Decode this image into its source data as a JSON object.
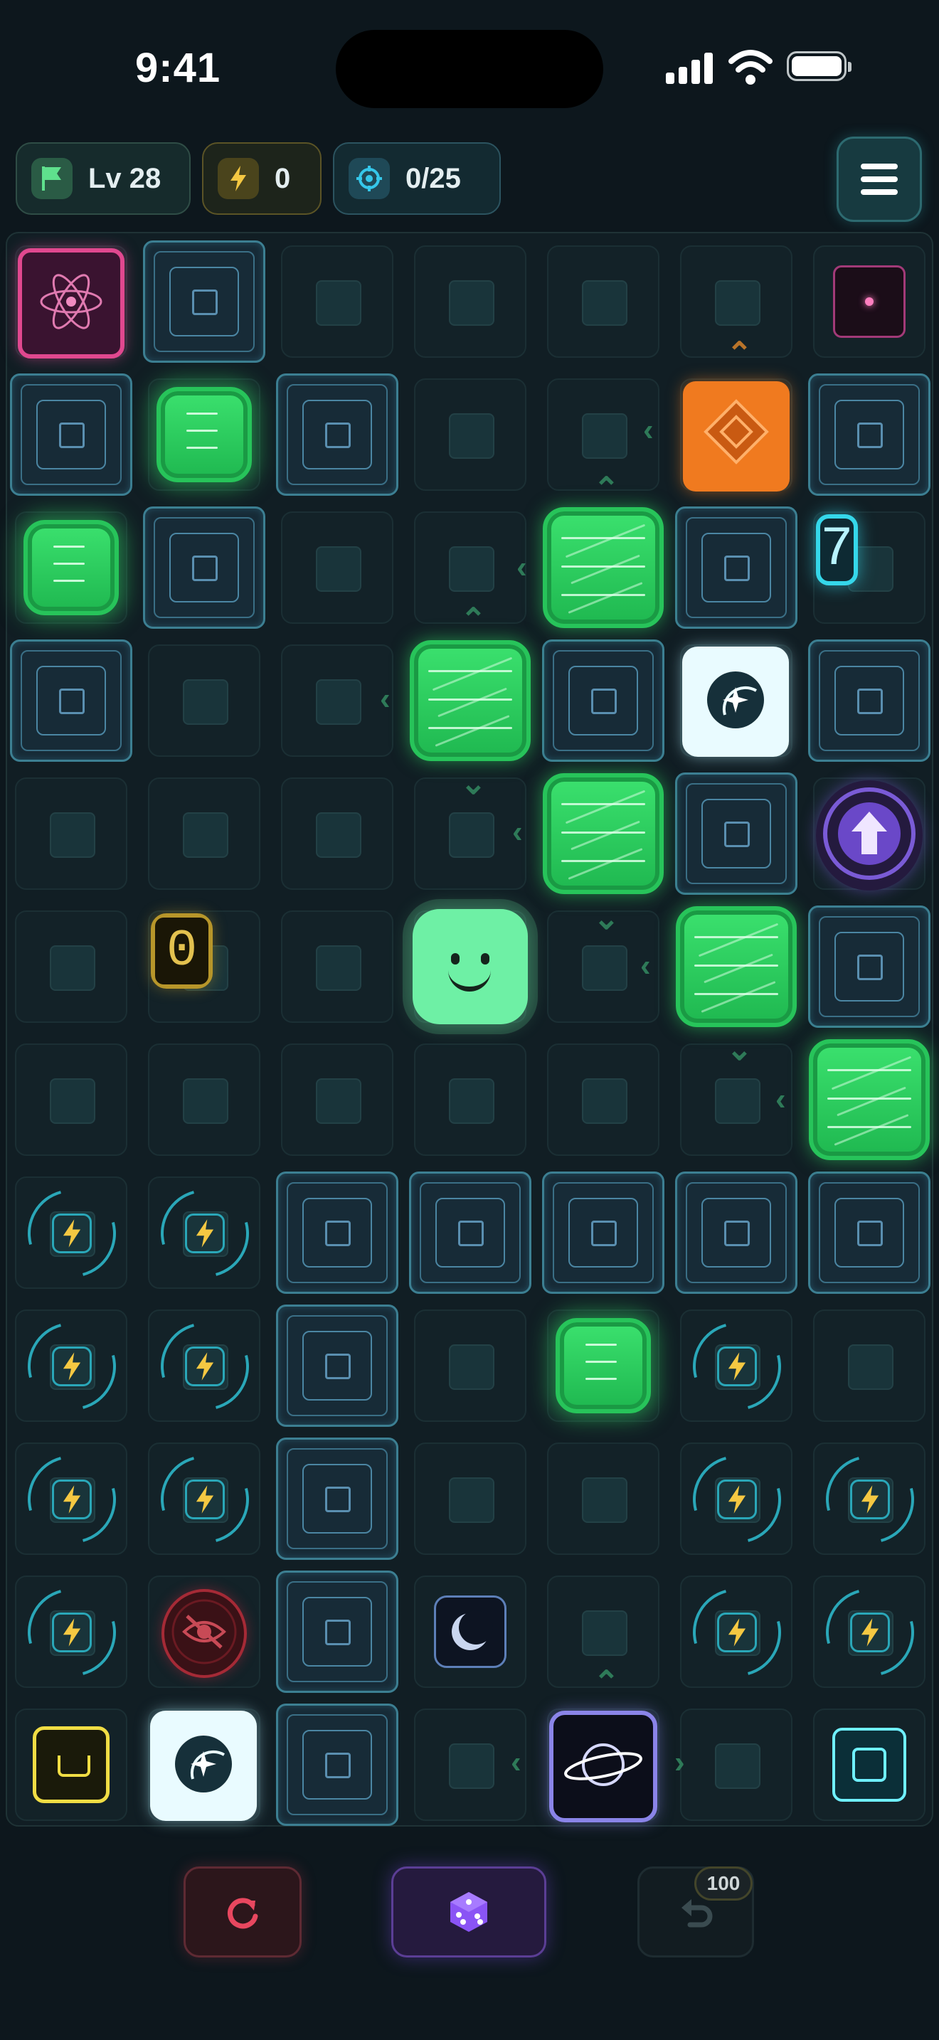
{
  "status_bar": {
    "time": "9:41"
  },
  "hud": {
    "level": "Lv 28",
    "energy": "0",
    "target": "0/25",
    "menu_icon": "hamburger-menu-icon"
  },
  "board": {
    "tiles": {
      "digit_seven": "7",
      "digit_zero": "0"
    }
  },
  "controls": {
    "restart_icon": "restart-icon",
    "dice_icon": "dice-icon",
    "undo_icon": "undo-icon",
    "undo_count": "100"
  },
  "colors": {
    "background": "#0d171d",
    "green_block": "#2fd160",
    "player": "#6ef0a5",
    "wall": "#3c7f92",
    "energy": "#f5c842",
    "cyan_accent": "#35d7ea",
    "orange": "#f07a1f",
    "pink": "#e0488f",
    "purple": "#7a5bd6"
  }
}
